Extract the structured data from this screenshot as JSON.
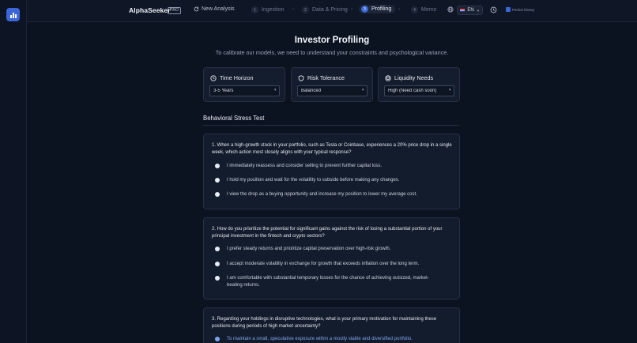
{
  "topbar": {
    "brand": "AlphaSeeker",
    "badge": "PRO",
    "new_analysis": "New Analysis",
    "steps": [
      {
        "num": "1",
        "label": "Ingestion"
      },
      {
        "num": "2",
        "label": "Data & Pricing"
      },
      {
        "num": "3",
        "label": "Profiling"
      },
      {
        "num": "4",
        "label": "Memo"
      }
    ],
    "language": "EN",
    "persist_label": "Persist history"
  },
  "main": {
    "title": "Investor Profiling",
    "subtitle": "To calibrate our models, we need to understand your constraints and psychological variance.",
    "cards": [
      {
        "label": "Time Horizon",
        "value": "3-5 Years"
      },
      {
        "label": "Risk Tolerance",
        "value": "Balanced"
      },
      {
        "label": "Liquidity Needs",
        "value": "High (Need cash soon)"
      }
    ],
    "section_title": "Behavioral Stress Test",
    "questions": [
      {
        "text": "1. When a high-growth stock in your portfolio, such as Tesla or Coinbase, experiences a 20% price drop in a single week, which action most closely aligns with your typical response?",
        "options": [
          "I immediately reassess and consider selling to prevent further capital loss.",
          "I hold my position and wait for the volatility to subside before making any changes.",
          "I view the drop as a buying opportunity and increase my position to lower my average cost."
        ]
      },
      {
        "text": "2. How do you prioritize the potential for significant gains against the risk of losing a substantial portion of your principal investment in the fintech and crypto sectors?",
        "options": [
          "I prefer steady returns and prioritize capital preservation over high-risk growth.",
          "I accept moderate volatility in exchange for growth that exceeds inflation over the long term.",
          "I am comfortable with substantial temporary losses for the chance of achieving outsized, market-beating returns."
        ]
      },
      {
        "text": "3. Regarding your holdings in disruptive technologies, what is your primary motivation for maintaining these positions during periods of high market uncertainty?",
        "options": [
          "To maintain a small, speculative exposure within a mostly stable and diversified portfolio."
        ]
      }
    ]
  }
}
